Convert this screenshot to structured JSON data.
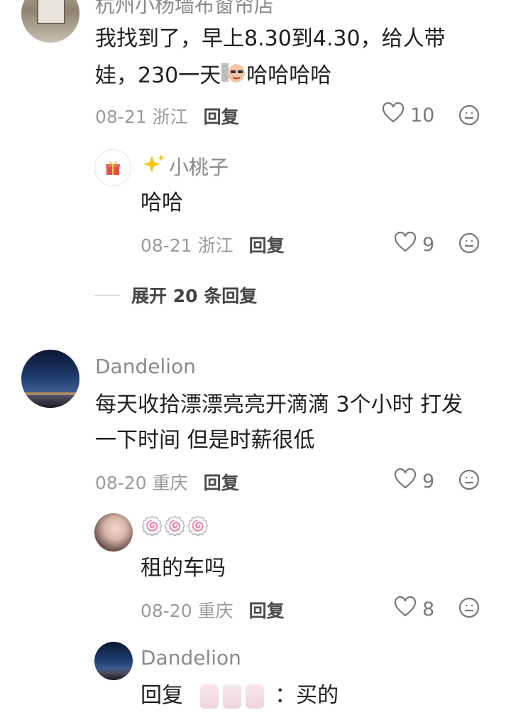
{
  "comments": [
    {
      "name": "杭州小杨墙布窗帘店",
      "text_line1": "我找到了，早上8.30到4.30，给人带",
      "text_line2a": "娃，230一天",
      "text_line2b": "哈哈哈哈",
      "date": "08-21",
      "location": "浙江",
      "reply_label": "回复",
      "likes": "10",
      "replies": [
        {
          "name": "小桃子",
          "text": "哈哈",
          "date": "08-21",
          "location": "浙江",
          "reply_label": "回复",
          "likes": "9"
        }
      ],
      "expand_label": "展开 20 条回复"
    },
    {
      "name": "Dandelion",
      "text_line1": "每天收拾漂漂亮亮开滴滴 3个小时 打发",
      "text_line2": "一下时间 但是时薪很低",
      "date": "08-20",
      "location": "重庆",
      "reply_label": "回复",
      "likes": "9",
      "replies": [
        {
          "name": "🍥🍥🍥",
          "text": "租的车吗",
          "date": "08-20",
          "location": "重庆",
          "reply_label": "回复",
          "likes": "8"
        },
        {
          "name": "Dandelion",
          "text_prefix": "回复",
          "text_suffix": "：买的"
        }
      ]
    }
  ],
  "icons": {
    "heart": "heart-icon",
    "emoji": "emoji-icon",
    "sparkle": "sparkle-icon",
    "gift": "gift-icon"
  },
  "colors": {
    "text": "#1f1f1f",
    "muted": "#9b9b9b",
    "name": "#8a8a8a"
  }
}
